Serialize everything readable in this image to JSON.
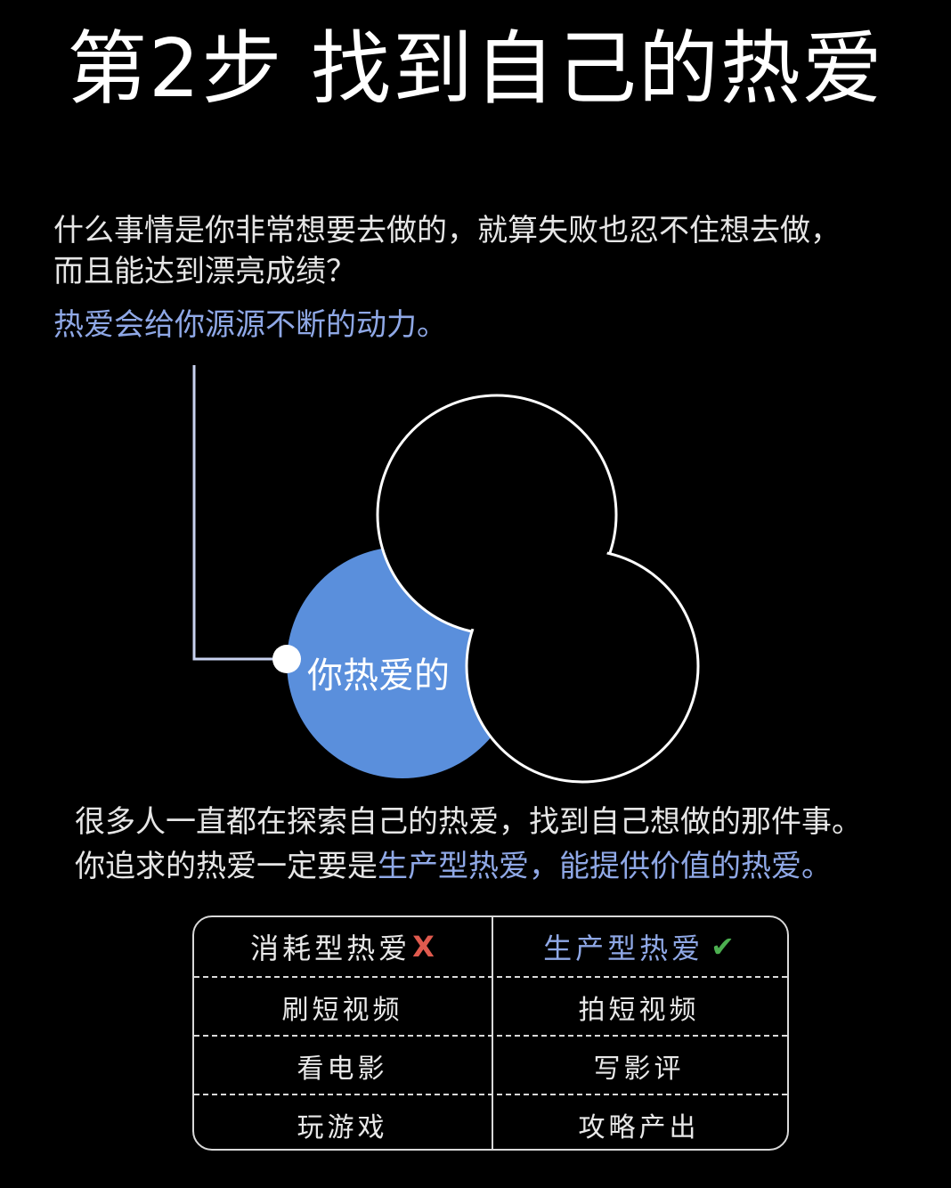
{
  "title": "第2步 找到自己的热爱",
  "intro": {
    "line1": "什么事情是你非常想要去做的，就算失败也忍不住想去做，",
    "line2": "而且能达到漂亮成绩？"
  },
  "tagline": "热爱会给你源源不断的动力。",
  "venn": {
    "label": "你热爱的",
    "highlight_color": "#5a8fdc"
  },
  "paragraph": {
    "line1": "很多人一直都在探索自己的热爱，找到自己想做的那件事。",
    "line2_plain": "你追求的热爱一定要是",
    "line2_highlight": "生产型热爱，能提供价值的热爱。"
  },
  "table": {
    "left_header": "消耗型热爱",
    "left_mark": "X",
    "right_header": "生产型热爱",
    "right_mark": "✔",
    "rows": [
      {
        "left": "刷短视频",
        "right": "拍短视频"
      },
      {
        "left": "看电影",
        "right": "写影评"
      },
      {
        "left": "玩游戏",
        "right": "攻略产出"
      }
    ]
  },
  "colors": {
    "background": "#000000",
    "accent_blue": "#8fa8e6",
    "venn_fill": "#5a8fdc",
    "cross": "#e05a4e",
    "check": "#4caf50"
  }
}
